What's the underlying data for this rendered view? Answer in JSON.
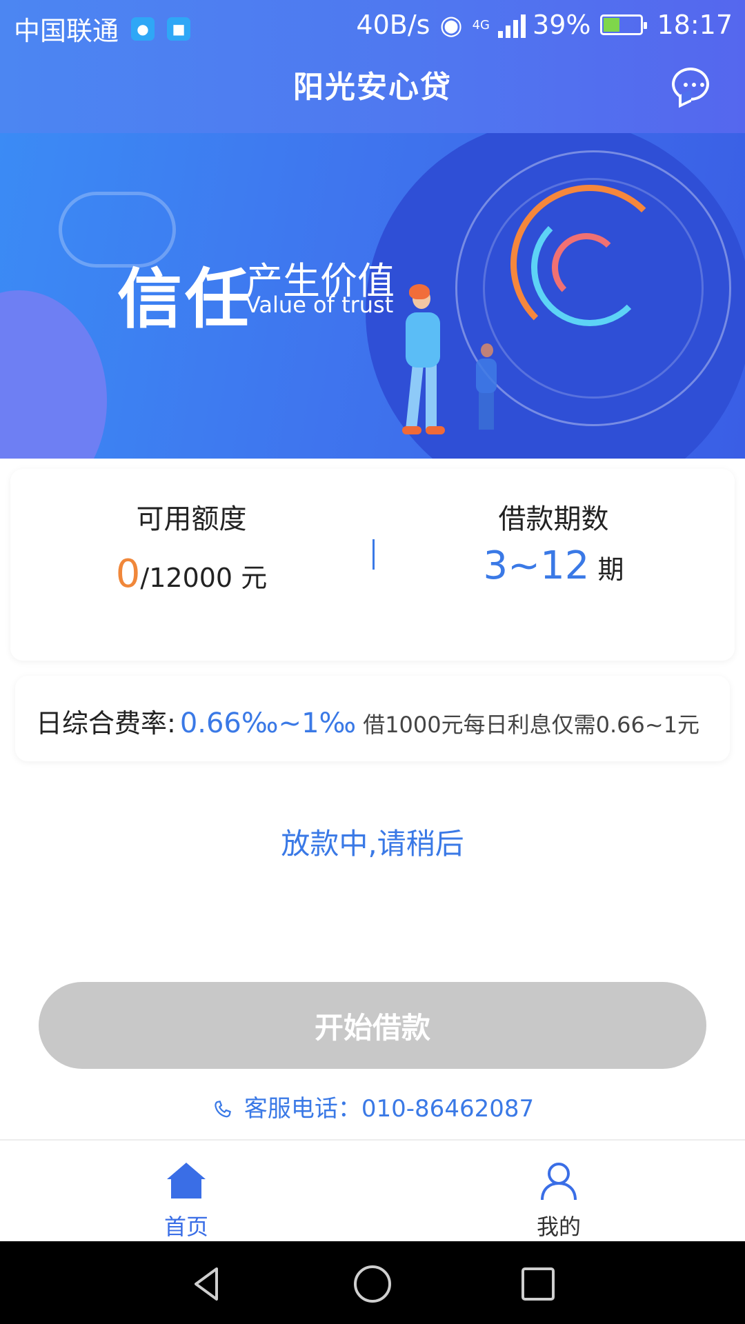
{
  "status_bar": {
    "carrier": "中国联通",
    "net_speed": "40B/s",
    "network": "4G",
    "battery": "39%",
    "time": "18:17",
    "icons": [
      "location-icon",
      "message-icon",
      "eye-icon",
      "signal-icon",
      "battery-icon"
    ]
  },
  "header": {
    "title": "阳光安心贷",
    "chat_icon": "chat-bubble-icon"
  },
  "banner": {
    "slogan_main": "信任",
    "slogan_sub": "产生价值",
    "slogan_en": "Value of trust"
  },
  "quota_card": {
    "quota_label": "可用额度",
    "quota_used": "0",
    "quota_total": "/12000",
    "quota_unit": " 元",
    "term_label": "借款期数",
    "term_range": "3~12",
    "term_unit": " 期"
  },
  "rate_card": {
    "label": "日综合费率:",
    "value": "0.66‰~1‰",
    "note": "借1000元每日利息仅需0.66~1元"
  },
  "status_message": "放款中,请稍后",
  "start_button": "开始借款",
  "hotline": {
    "label": "客服电话：",
    "number": "010-86462087"
  },
  "tabbar": {
    "home": "首页",
    "mine": "我的"
  },
  "colors": {
    "accent": "#3a79e6",
    "orange": "#f0873a",
    "disabled_button": "#c8c8c8",
    "header_blue": "#4f78f0"
  }
}
